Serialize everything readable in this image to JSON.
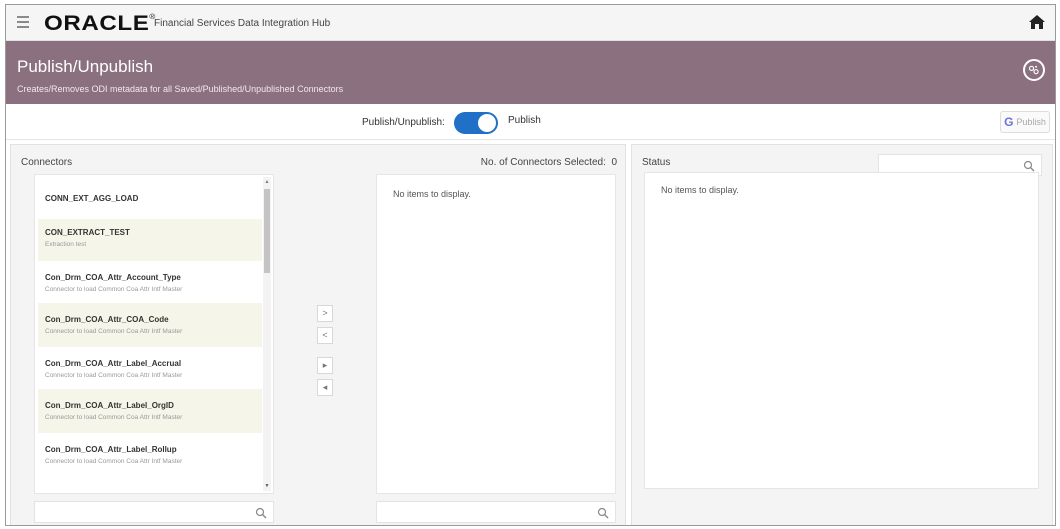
{
  "header": {
    "logo": "ORACLE",
    "app_title": "Financial Services Data Integration Hub",
    "menu_icon": "hamburger-menu-icon",
    "home_icon": "home-icon"
  },
  "banner": {
    "title": "Publish/Unpublish",
    "subtitle": "Creates/Removes ODI metadata for all Saved/Published/Unpublished Connectors",
    "icon": "settings-circle-icon"
  },
  "toolbar": {
    "toggle_label": "Publish/Unpublish:",
    "toggle_state": "Publish",
    "toggle_on": true,
    "publish_button": "Publish"
  },
  "connectors": {
    "header": "Connectors",
    "count_label": "No. of Connectors Selected:",
    "count": "0",
    "items": [
      {
        "name": "CONN_EXT_AGG_LOAD",
        "desc": ""
      },
      {
        "name": "CON_EXTRACT_TEST",
        "desc": "Extraction test"
      },
      {
        "name": "Con_Drm_COA_Attr_Account_Type",
        "desc": "Connector to load Common Coa Attr Intf Master"
      },
      {
        "name": "Con_Drm_COA_Attr_COA_Code",
        "desc": "Connector to load Common Coa Attr Intf Master"
      },
      {
        "name": "Con_Drm_COA_Attr_Label_Accrual",
        "desc": "Connector to load Common Coa Attr Intf Master"
      },
      {
        "name": "Con_Drm_COA_Attr_Label_OrgID",
        "desc": "Connector to load Common Coa Attr Intf Master"
      },
      {
        "name": "Con_Drm_COA_Attr_Label_Rollup",
        "desc": "Connector to load Common Coa Attr Intf Master"
      }
    ],
    "shuttle": [
      ">",
      "<",
      "▸",
      "◂"
    ],
    "selected_empty": "No items to display."
  },
  "status": {
    "header": "Status",
    "empty": "No items to display."
  },
  "colors": {
    "banner": "#8b7080",
    "toggle": "#1f70c6",
    "alt_row": "#f6f5ea"
  }
}
